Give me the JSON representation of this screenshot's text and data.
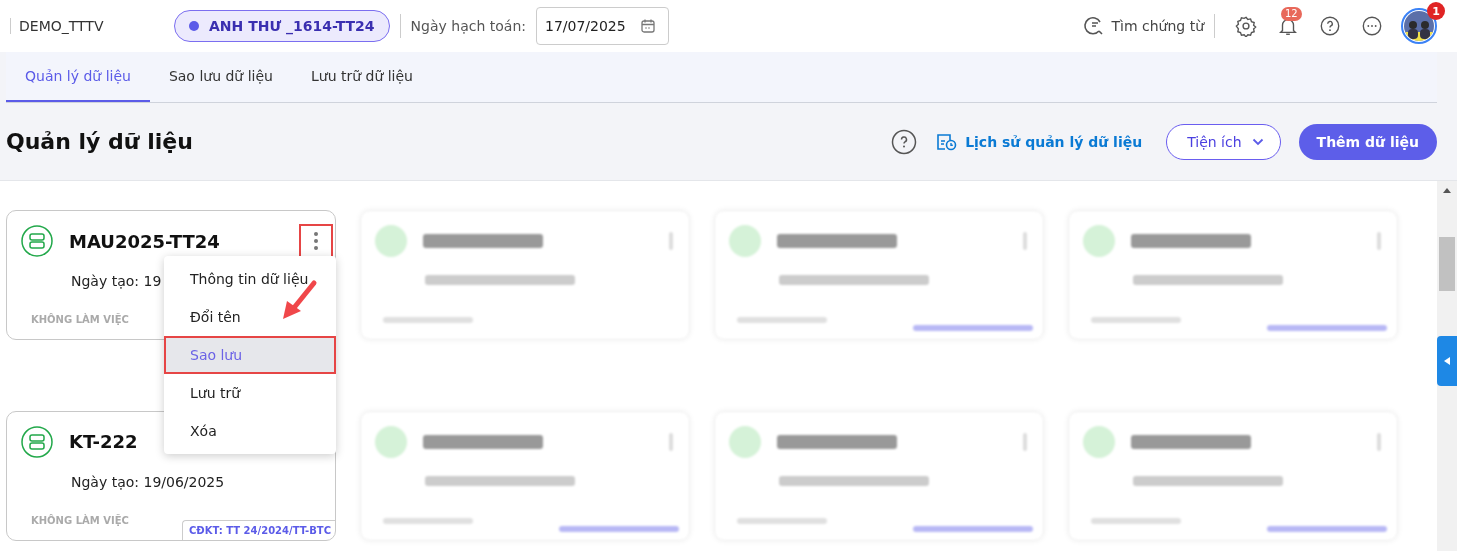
{
  "topbar": {
    "company": "DEMO_TTTV",
    "dataset": "ANH THƯ _1614-TT24",
    "date_label": "Ngày hạch toán:",
    "date_value": "17/07/2025",
    "search_label": "Tìm chứng từ",
    "notification_count": "12",
    "avatar_badge": "1"
  },
  "tabs": [
    {
      "label": "Quản lý dữ liệu",
      "selected": true
    },
    {
      "label": "Sao lưu dữ liệu",
      "selected": false
    },
    {
      "label": "Lưu trữ dữ liệu",
      "selected": false
    }
  ],
  "header": {
    "title": "Quản lý dữ liệu",
    "history_link": "Lịch sử quản lý dữ liệu",
    "utilities_button": "Tiện ích",
    "add_button": "Thêm dữ liệu"
  },
  "cards": [
    {
      "kind": "data",
      "name": "MAU2025-TT24",
      "date": "Ngày tạo: 19",
      "status": "KHÔNG LÀM VIỆC",
      "menu_annotated": true
    },
    {
      "kind": "blurred",
      "has_tag": false
    },
    {
      "kind": "blurred",
      "has_tag": true
    },
    {
      "kind": "blurred",
      "has_tag": true
    },
    {
      "kind": "data",
      "name": "KT-222",
      "date": "Ngày tạo: 19/06/2025",
      "status": "KHÔNG LÀM VIỆC",
      "tag": "CĐKT: TT 24/2024/TT-BTC"
    },
    {
      "kind": "blurred",
      "has_tag": true
    },
    {
      "kind": "blurred",
      "has_tag": true
    },
    {
      "kind": "blurred",
      "has_tag": true
    }
  ],
  "context_menu": {
    "items": [
      {
        "label": "Thông tin dữ liệu",
        "selected": false,
        "annotated": false
      },
      {
        "label": "Đổi tên",
        "selected": false,
        "annotated": false
      },
      {
        "label": "Sao lưu",
        "selected": true,
        "annotated": true
      },
      {
        "label": "Lưu trữ",
        "selected": false,
        "annotated": false
      },
      {
        "label": "Xóa",
        "selected": false,
        "annotated": false
      }
    ]
  }
}
